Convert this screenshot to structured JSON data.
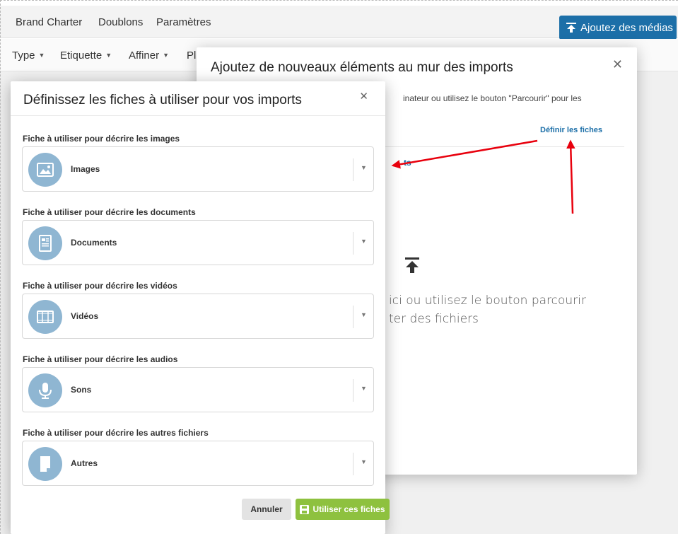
{
  "topbar": {
    "nav": [
      "Brand Charter",
      "Doublons",
      "Paramètres"
    ],
    "upload_label": "Ajoutez des médias"
  },
  "filters": {
    "items": [
      "Type",
      "Etiquette",
      "Affiner",
      "Pl"
    ]
  },
  "back_modal": {
    "title": "Ajoutez de nouveaux éléments au mur des imports",
    "intro": "inateur ou utilisez le bouton \"Parcourir\" pour les",
    "define_link": "Définir les fiches",
    "fragment": "ts",
    "drop_line1": "ici ou utilisez le bouton parcourir",
    "drop_line2": "ter des fichiers"
  },
  "front_modal": {
    "title": "Définissez les fiches à utiliser pour vos imports",
    "fields": [
      {
        "label": "Fiche à utiliser pour décrire les images",
        "value": "Images",
        "icon": "image-icon"
      },
      {
        "label": "Fiche à utiliser pour décrire les documents",
        "value": "Documents",
        "icon": "document-icon"
      },
      {
        "label": "Fiche à utiliser pour décrire les vidéos",
        "value": "Vidéos",
        "icon": "film-icon"
      },
      {
        "label": "Fiche à utiliser pour décrire les audios",
        "value": "Sons",
        "icon": "microphone-icon"
      },
      {
        "label": "Fiche à utiliser pour décrire les autres fichiers",
        "value": "Autres",
        "icon": "file-icon"
      }
    ],
    "cancel_label": "Annuler",
    "use_label": "Utiliser ces fiches"
  },
  "colors": {
    "brand_blue": "#1c6fa8",
    "accent_green": "#8ec13f",
    "icon_circle": "#8fb6d2",
    "annotation_red": "#e8000d"
  }
}
